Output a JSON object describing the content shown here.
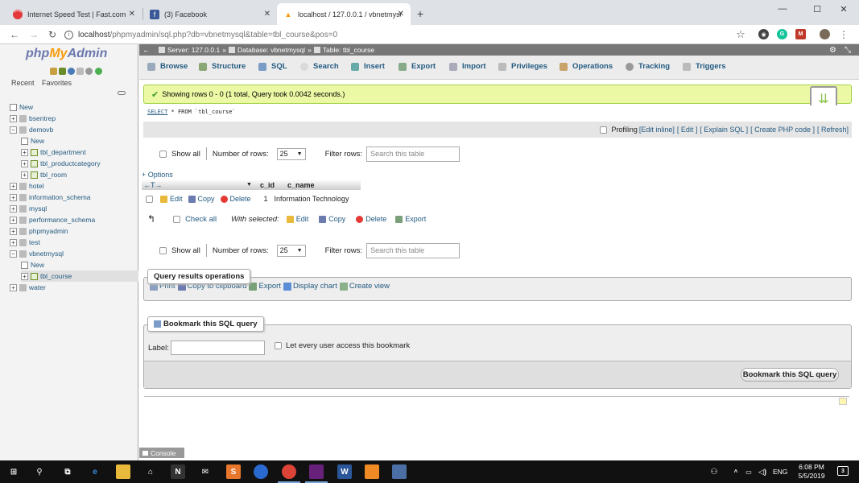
{
  "browser": {
    "tabs": [
      {
        "title": "Internet Speed Test | Fast.com",
        "icon": "fast-icon",
        "active": false
      },
      {
        "title": "(3) Facebook",
        "icon": "facebook-icon",
        "active": false
      },
      {
        "title": "localhost / 127.0.0.1 / vbnetmysq",
        "icon": "phpmyadmin-icon",
        "active": true
      }
    ],
    "new_tab": "+",
    "url_host": "localhost",
    "url_path": "/phpmyadmin/sql.php?db=vbnetmysql&table=tbl_course&pos=0"
  },
  "sidebar": {
    "logo_php": "php",
    "logo_my": "My",
    "logo_admin": "Admin",
    "recent": "Recent",
    "favorites": "Favorites",
    "tree": [
      {
        "label": "New",
        "kind": "new",
        "level": 0
      },
      {
        "label": "bsentrep",
        "kind": "db",
        "level": 0
      },
      {
        "label": "demovb",
        "kind": "db",
        "level": 0,
        "expanded": true
      },
      {
        "label": "New",
        "kind": "new",
        "level": 1
      },
      {
        "label": "tbl_department",
        "kind": "table",
        "level": 1
      },
      {
        "label": "tbl_productcategory",
        "kind": "table",
        "level": 1
      },
      {
        "label": "tbl_room",
        "kind": "table",
        "level": 1
      },
      {
        "label": "hotel",
        "kind": "db",
        "level": 0
      },
      {
        "label": "information_schema",
        "kind": "db",
        "level": 0
      },
      {
        "label": "mysql",
        "kind": "db",
        "level": 0
      },
      {
        "label": "performance_schema",
        "kind": "db",
        "level": 0
      },
      {
        "label": "phpmyadmin",
        "kind": "db",
        "level": 0
      },
      {
        "label": "test",
        "kind": "db",
        "level": 0
      },
      {
        "label": "vbnetmysql",
        "kind": "db",
        "level": 0,
        "expanded": true
      },
      {
        "label": "New",
        "kind": "new",
        "level": 1
      },
      {
        "label": "tbl_course",
        "kind": "table",
        "level": 1,
        "selected": true
      },
      {
        "label": "water",
        "kind": "db",
        "level": 0
      }
    ]
  },
  "breadcrumb": {
    "server": "Server: 127.0.0.1",
    "database": "Database: vbnetmysql",
    "table": "Table: tbl_course",
    "sep": "»"
  },
  "main_tabs": [
    "Browse",
    "Structure",
    "SQL",
    "Search",
    "Insert",
    "Export",
    "Import",
    "Privileges",
    "Operations",
    "Tracking",
    "Triggers"
  ],
  "result": {
    "success_msg": "Showing rows 0 - 0 (1 total, Query took 0.0042 seconds.)",
    "sql_kw": "SELECT",
    "sql_rest": " * FROM `tbl_course`",
    "profiling": "Profiling",
    "edit_inline": "[Edit inline]",
    "edit": "[ Edit ]",
    "explain": "[ Explain SQL ]",
    "create_php": "[ Create PHP code ]",
    "refresh": "[ Refresh]"
  },
  "nav": {
    "show_all": "Show all",
    "num_rows_label": "Number of rows:",
    "num_rows_value": "25",
    "filter_label": "Filter rows:",
    "filter_placeholder": "Search this table"
  },
  "table": {
    "options": "+ Options",
    "arrows": "←T→",
    "columns": [
      "c_id",
      "c_name"
    ],
    "row_actions": {
      "edit": "Edit",
      "copy": "Copy",
      "delete": "Delete"
    },
    "rows": [
      {
        "c_id": "1",
        "c_name": "Information Technology"
      }
    ]
  },
  "with_selected": {
    "check_all": "Check all",
    "label": "With selected:",
    "edit": "Edit",
    "copy": "Copy",
    "delete": "Delete",
    "export": "Export"
  },
  "qro": {
    "legend": "Query results operations",
    "print": "Print",
    "copy_clip": "Copy to clipboard",
    "export": "Export",
    "display_chart": "Display chart",
    "create_view": "Create view"
  },
  "bookmark": {
    "legend": "Bookmark this SQL query",
    "label": "Label:",
    "let_every": "Let every user access this bookmark",
    "button": "Bookmark this SQL query"
  },
  "console": "Console",
  "taskbar": {
    "ime": "ENG",
    "time": "6:08 PM",
    "date": "5/5/2019",
    "notif": "3"
  }
}
